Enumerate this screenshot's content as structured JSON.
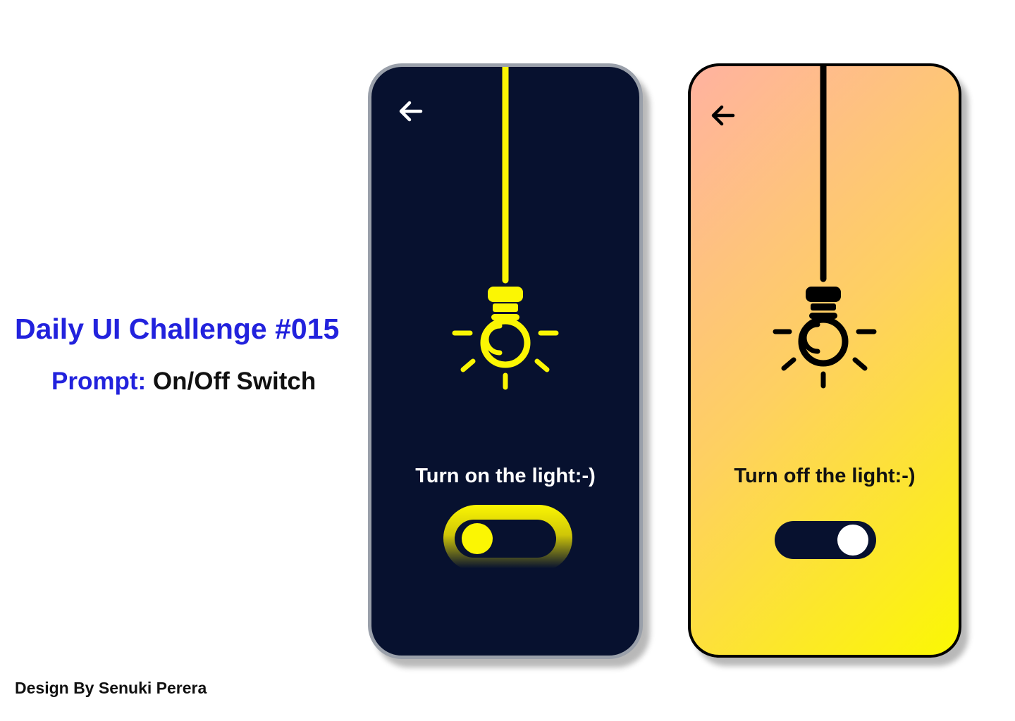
{
  "header": {
    "title": "Daily UI Challenge #015",
    "prompt_label": "Prompt:",
    "prompt_value": "On/Off Switch"
  },
  "credit": "Design By Senuki Perera",
  "screens": {
    "dark": {
      "label": "Turn on the light:-)",
      "background": "#07112f",
      "accent": "#fbf603",
      "toggle_state": "on",
      "back_icon": "arrow-left-icon",
      "bulb_icon": "lightbulb-icon"
    },
    "light": {
      "label": "Turn off the light:-)",
      "gradient": [
        "#ffb2a0",
        "#fed061",
        "#fbf803"
      ],
      "accent": "#000000",
      "toggle_state": "off",
      "back_icon": "arrow-left-icon",
      "bulb_icon": "lightbulb-icon"
    }
  }
}
